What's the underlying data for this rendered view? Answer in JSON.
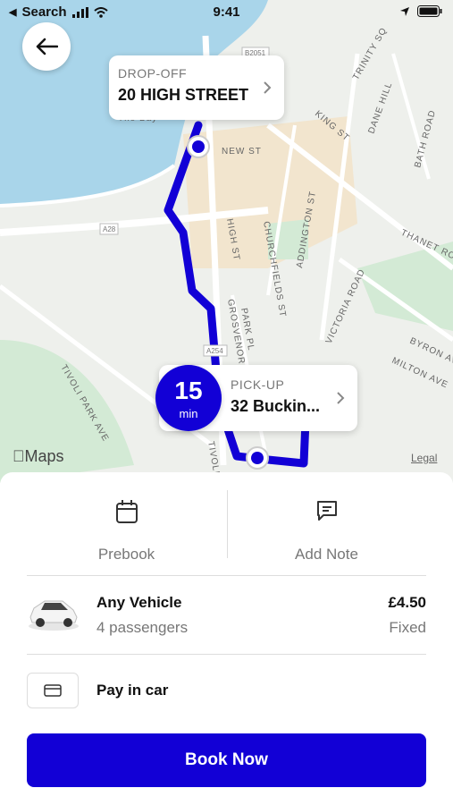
{
  "status": {
    "back_label": "Search",
    "time": "9:41"
  },
  "map": {
    "dropoff": {
      "label": "DROP-OFF",
      "address": "20 HIGH STREET"
    },
    "pickup": {
      "label": "PICK-UP",
      "address": "32 Buckin..."
    },
    "eta": {
      "value": "15",
      "unit": "min"
    },
    "streets": [
      "TRINITY SQ",
      "KING ST",
      "DANE HILL",
      "BATH ROAD",
      "NEW ST",
      "HIGH ST",
      "CHURCHFIELDS ST",
      "ADDINGTON ST",
      "THANET ROAD",
      "VICTORIA ROAD",
      "PARK PL",
      "GROSVENOR PL",
      "BYRON AV",
      "MILTON AVE",
      "TIVOLI PARK AVE",
      "TIVOLI",
      "The Bay",
      "A254",
      "A28",
      "B2051"
    ],
    "attribution": "Maps",
    "legal": "Legal"
  },
  "sheet": {
    "prebook_label": "Prebook",
    "note_label": "Add Note",
    "vehicle": {
      "name": "Any Vehicle",
      "passengers": "4 passengers",
      "price": "£4.50",
      "price_type": "Fixed"
    },
    "payment_label": "Pay in car",
    "book_label": "Book Now"
  },
  "colors": {
    "accent": "#1200d6",
    "water": "#a9d5ea",
    "park": "#d3ead5",
    "town": "#f6dcb6"
  }
}
